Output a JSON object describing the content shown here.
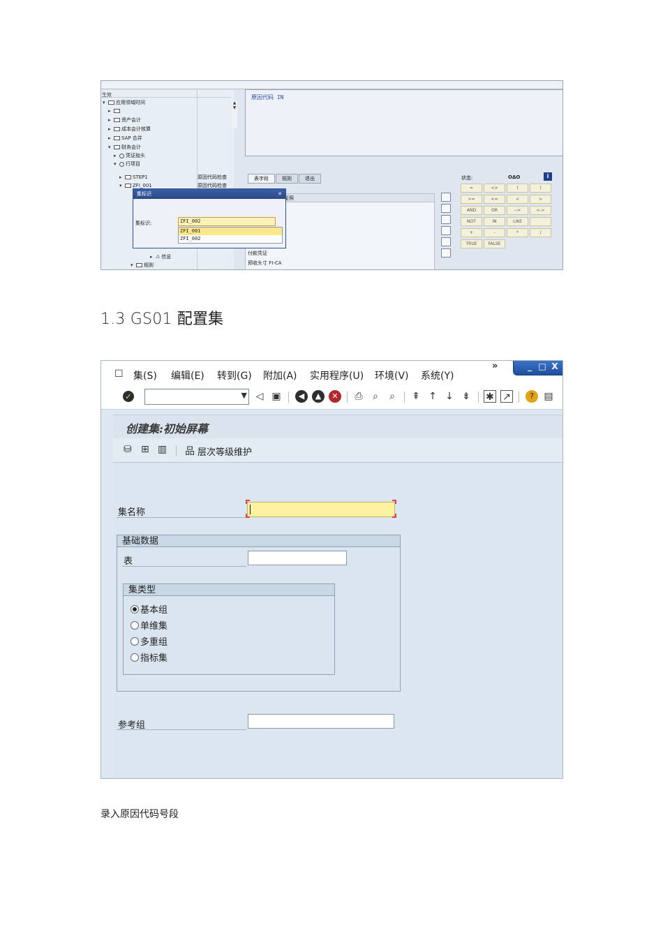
{
  "screenshot1": {
    "tree_header": "生效",
    "tree_rows": [
      {
        "text": "应用领域时间",
        "indent": 0,
        "icon": "folder-open"
      },
      {
        "text": "",
        "indent": 1,
        "icon": "folder"
      },
      {
        "text": "资产会计",
        "indent": 1,
        "icon": "folder"
      },
      {
        "text": "成本会计核算",
        "indent": 1,
        "icon": "folder"
      },
      {
        "text": "SAP 合并",
        "indent": 1,
        "icon": "folder"
      },
      {
        "text": "财务会计",
        "indent": 1,
        "icon": "folder-open"
      },
      {
        "text": "凭证抬头",
        "indent": 2,
        "icon": "clock"
      },
      {
        "text": "行项目",
        "indent": 2,
        "icon": "clock"
      },
      {
        "text": "STEP1",
        "indent": 3,
        "icon": "folder"
      },
      {
        "text": "ZFI_001",
        "indent": 3,
        "icon": "folder-open"
      }
    ],
    "tree_desc": [
      "原因代码检查",
      "原因代码检查"
    ],
    "tree_bottom_rows": [
      "信息",
      "规则"
    ],
    "editor_text": "原因代码 IN",
    "tabs": [
      "表字段",
      "规则",
      "退出"
    ],
    "field_panel_header": "证照",
    "field_panel_rows": [
      "付款凭证",
      "预收头寸 FI-CA"
    ],
    "status_label": "状态:",
    "status_value": "OΔO",
    "operators": [
      "=",
      "<>",
      "(",
      ")",
      ">=",
      "<=",
      "<",
      ">",
      "AND",
      "OR",
      "-->",
      "<->",
      "NOT",
      "IN",
      "LIKE",
      "",
      "+",
      "-",
      "*",
      "/",
      "TRUE",
      "FALSE"
    ],
    "dialog": {
      "title": "集标识",
      "label": "集标识:",
      "input_value": "ZFI_002",
      "options": [
        "ZFI_001",
        "ZFI_002"
      ]
    }
  },
  "section_heading": "1.3 GS01  配置集",
  "screenshot2": {
    "menu": [
      "集(S)",
      "编辑(E)",
      "转到(G)",
      "附加(A)",
      "实用程序(U)",
      "环境(V)",
      "系统(Y)"
    ],
    "chevron": "»",
    "window_buttons": [
      "_",
      "□",
      "X"
    ],
    "screen_title": "创建集:初始屏幕",
    "hierarchy_label": "层次等级维护",
    "set_name_label": "集名称",
    "set_name_value": "",
    "basic_data_title": "基础数据",
    "table_label": "表",
    "table_value": "",
    "set_type_title": "集类型",
    "set_types": [
      {
        "label": "基本组",
        "selected": true
      },
      {
        "label": "单维集",
        "selected": false
      },
      {
        "label": "多重组",
        "selected": false
      },
      {
        "label": "指标集",
        "selected": false
      }
    ],
    "ref_group_label": "参考组",
    "ref_group_value": ""
  },
  "caption": "录入原因代码号段"
}
